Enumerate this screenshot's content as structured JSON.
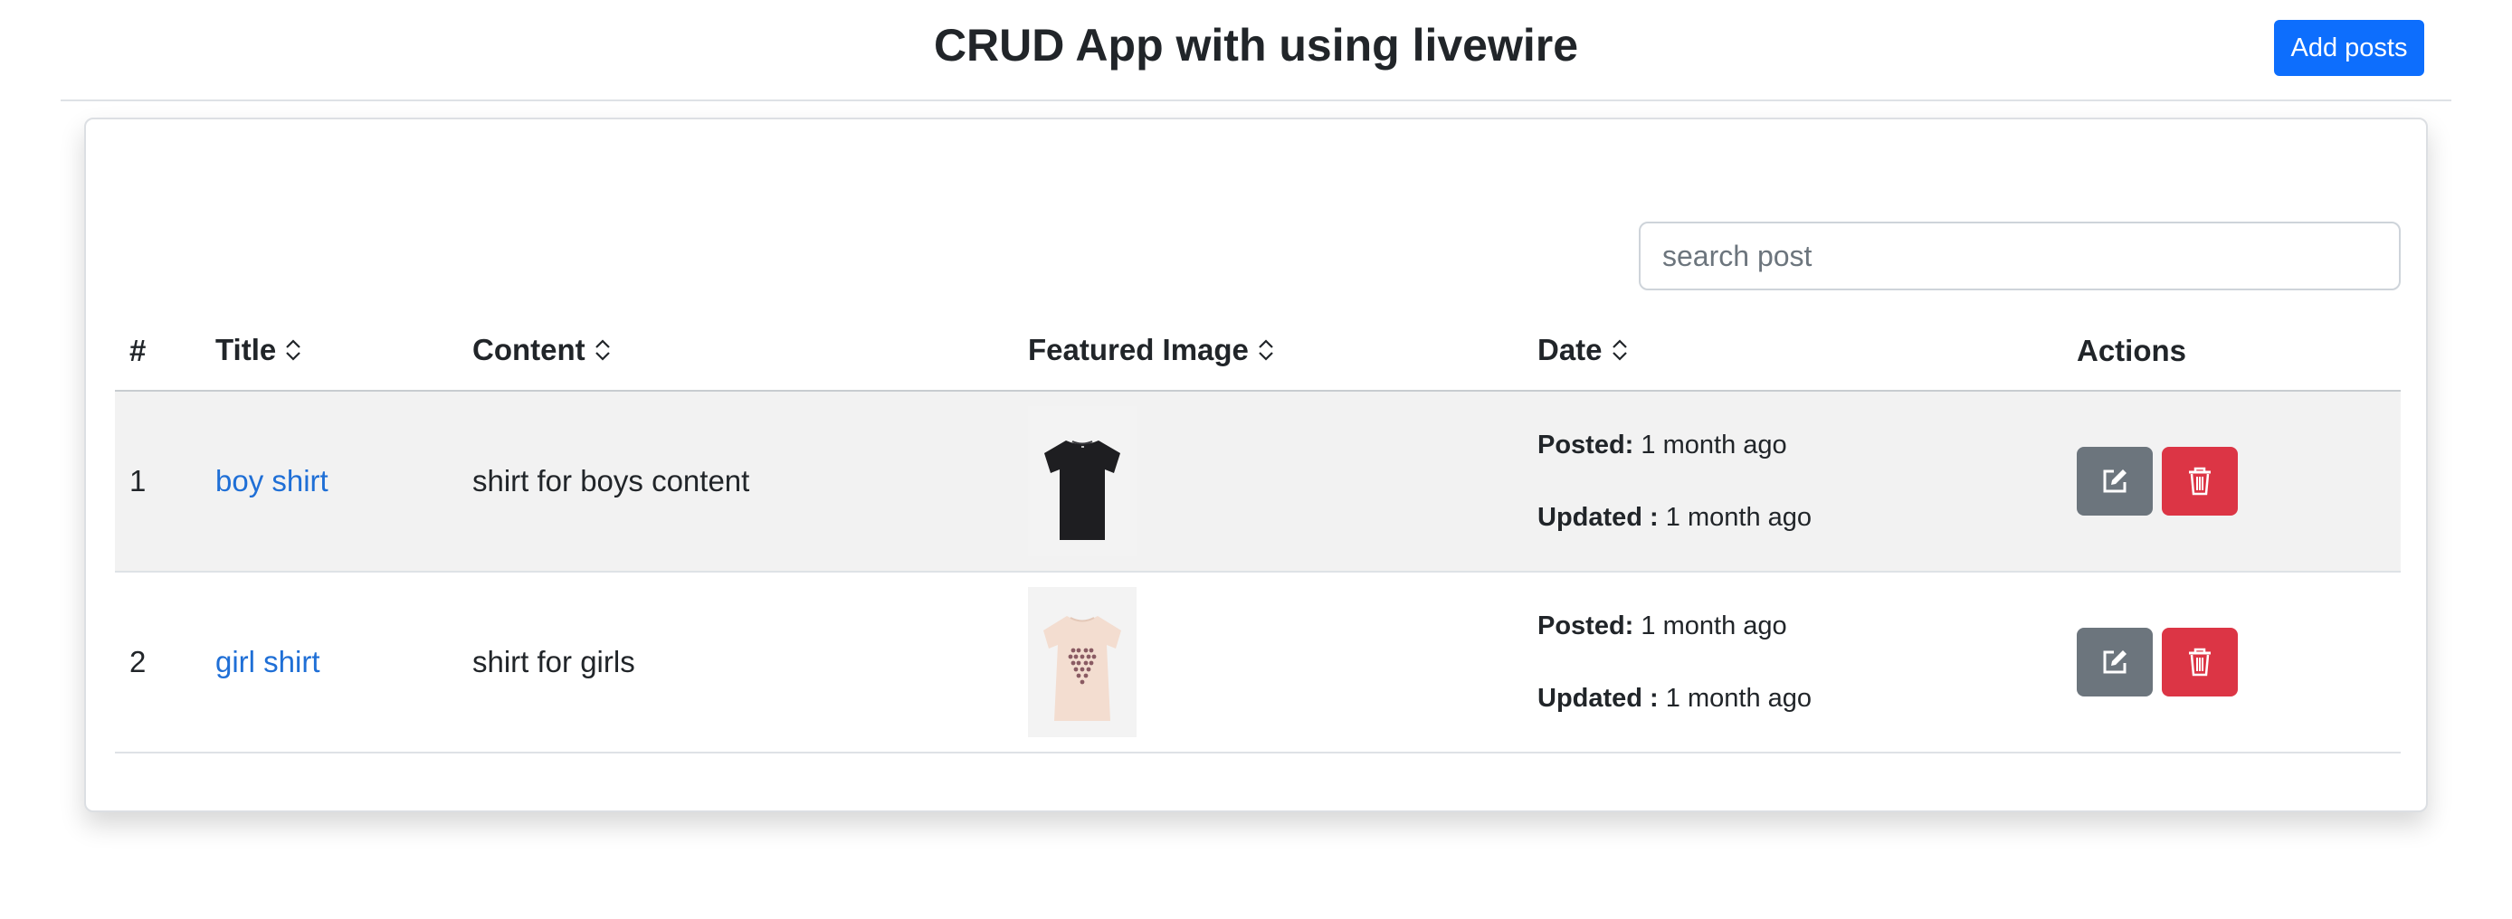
{
  "header": {
    "title": "CRUD App with using livewire",
    "add_button": "Add posts"
  },
  "search": {
    "placeholder": "search post",
    "value": ""
  },
  "table": {
    "columns": {
      "num": "#",
      "title": "Title",
      "content": "Content",
      "image": "Featured Image",
      "date": "Date",
      "actions": "Actions"
    },
    "rows": [
      {
        "num": "1",
        "title": "boy shirt",
        "content": "shirt for boys content",
        "image_icon": "black-tshirt-image",
        "posted_label": "Posted:",
        "posted": "1 month ago",
        "updated_label": "Updated :",
        "updated": "1 month ago"
      },
      {
        "num": "2",
        "title": "girl shirt",
        "content": "shirt for girls",
        "image_icon": "cream-heart-tshirt-image",
        "posted_label": "Posted:",
        "posted": "1 month ago",
        "updated_label": "Updated :",
        "updated": "1 month ago"
      }
    ]
  },
  "icons": {
    "sort": "sort-icon",
    "edit": "edit-icon",
    "delete": "trash-icon"
  },
  "colors": {
    "primary": "#0d6efd",
    "link": "#1f6fd6",
    "edit_button": "#6c757d",
    "delete_button": "#dc3545",
    "stripe": "#f2f2f2"
  }
}
